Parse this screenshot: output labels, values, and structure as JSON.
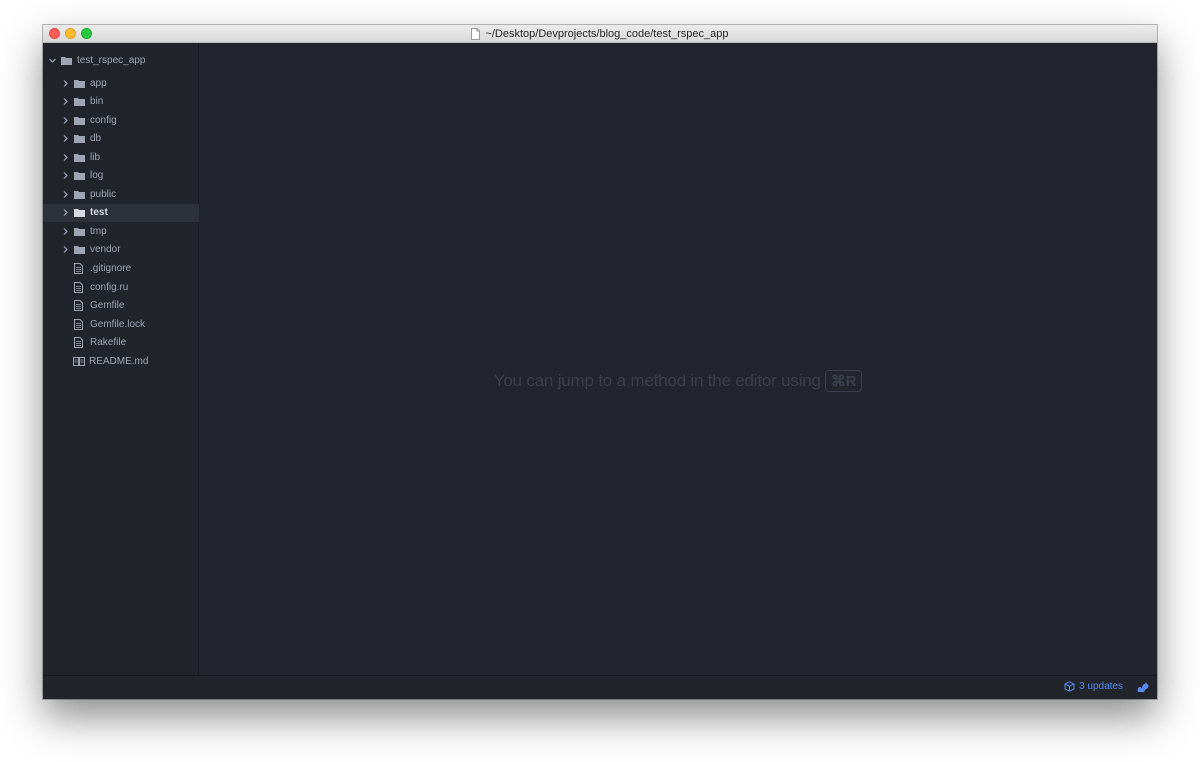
{
  "window": {
    "title": "~/Desktop/Devprojects/blog_code/test_rspec_app"
  },
  "sidebar": {
    "root": {
      "label": "test_rspec_app",
      "expanded": true
    },
    "items": [
      {
        "type": "folder",
        "label": "app"
      },
      {
        "type": "folder",
        "label": "bin"
      },
      {
        "type": "folder",
        "label": "config"
      },
      {
        "type": "folder",
        "label": "db"
      },
      {
        "type": "folder",
        "label": "lib"
      },
      {
        "type": "folder",
        "label": "log"
      },
      {
        "type": "folder",
        "label": "public"
      },
      {
        "type": "folder",
        "label": "test",
        "selected": true
      },
      {
        "type": "folder",
        "label": "tmp"
      },
      {
        "type": "folder",
        "label": "vendor"
      },
      {
        "type": "file",
        "label": ".gitignore"
      },
      {
        "type": "file",
        "label": "config.ru"
      },
      {
        "type": "file",
        "label": "Gemfile"
      },
      {
        "type": "file",
        "label": "Gemfile.lock"
      },
      {
        "type": "file",
        "label": "Rakefile"
      },
      {
        "type": "readme",
        "label": "README.md"
      }
    ]
  },
  "main": {
    "hint_text": "You can jump to a method in the editor using",
    "hint_shortcut": "⌘R"
  },
  "statusbar": {
    "updates_label": "3 updates",
    "icons": [
      "package-icon",
      "squirrel-icon"
    ]
  },
  "colors": {
    "background": "#21252b",
    "text": "#9da5b4",
    "accent": "#568af2",
    "selected_row": "#2c313a"
  }
}
